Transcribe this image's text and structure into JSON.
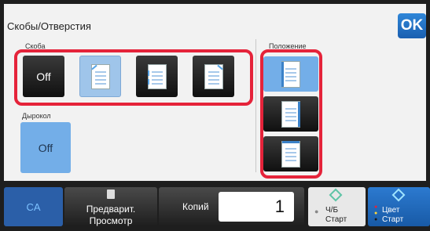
{
  "title": "Скобы/Отверстия",
  "ok_label": "OK",
  "staple": {
    "section_label": "Скоба",
    "off_label": "Off",
    "options": [
      {
        "id": "off",
        "label": "Off"
      },
      {
        "id": "one-staple-left-top",
        "icon": "staple-top-left-icon"
      },
      {
        "id": "two-staples-left",
        "icon": "staple-left-two-icon"
      },
      {
        "id": "one-staple-right-top",
        "icon": "staple-top-right-icon"
      }
    ],
    "selected": "one-staple-left-top"
  },
  "punch": {
    "section_label": "Дырокол",
    "off_label": "Off"
  },
  "position": {
    "section_label": "Положение",
    "options": [
      "left",
      "right",
      "top"
    ],
    "selected": "left"
  },
  "bottom_bar": {
    "ca_label": "CA",
    "preview_line1": "Предварит.",
    "preview_line2": "Просмотр",
    "copies_label": "Копий",
    "copies_value": "1",
    "bw_line1": "Ч/Б",
    "bw_line2": "Старт",
    "color_line1": "Цвет",
    "color_line2": "Старт"
  }
}
